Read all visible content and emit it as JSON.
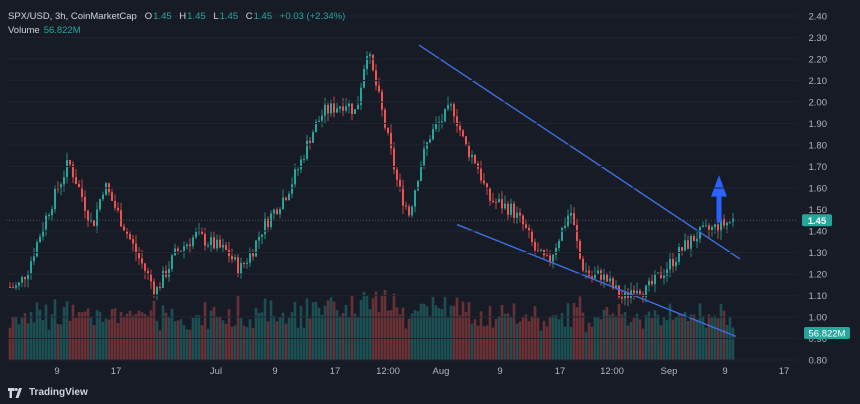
{
  "legend": {
    "symbol": "SPX/USD, 3h, CoinMarketCap",
    "o_label": "O",
    "o": "1.45",
    "h_label": "H",
    "h": "1.45",
    "l_label": "L",
    "l": "1.45",
    "c_label": "C",
    "c": "1.45",
    "change": "+0.03 (+2.34%)",
    "volume_label": "Volume",
    "volume_value": "56.822M"
  },
  "branding": {
    "name": "TradingView"
  },
  "colors": {
    "background": "#171b26",
    "up": "#26a69a",
    "down": "#ef5350",
    "trendline": "#3f6fe0",
    "arrow": "#2962ff",
    "text": "#b2b5be",
    "price_tag": "#26a69a",
    "volume_tag": "#26a69a"
  },
  "chart_data": {
    "type": "candlestick",
    "ylim": [
      0.8,
      2.4
    ],
    "y_ticks": [
      "2.40",
      "2.30",
      "2.20",
      "2.10",
      "2.00",
      "1.90",
      "1.80",
      "1.70",
      "1.60",
      "1.50",
      "1.40",
      "1.30",
      "1.20",
      "1.10",
      "1.00",
      "0.90",
      "0.80"
    ],
    "x_ticks": [
      "9",
      "17",
      "Jul",
      "9",
      "17",
      "12:00",
      "Aug",
      "9",
      "17",
      "12:00",
      "Sep",
      "9",
      "17"
    ],
    "last_price": "1.45",
    "last_volume": "56.822M",
    "close_path": [
      [
        "9",
        1.14
      ],
      [
        "9",
        1.22
      ],
      [
        "9",
        1.35
      ],
      [
        "9",
        1.48
      ],
      [
        "17",
        1.72
      ],
      [
        "17",
        1.58
      ],
      [
        "17",
        1.42
      ],
      [
        "17",
        1.62
      ],
      [
        "Jul",
        1.3
      ],
      [
        "Jul",
        1.12
      ],
      [
        "Jul",
        1.3
      ],
      [
        "Jul",
        1.38
      ],
      [
        "9",
        1.3
      ],
      [
        "9",
        1.22
      ],
      [
        "9",
        1.3
      ],
      [
        "9",
        1.42
      ],
      [
        "17",
        1.58
      ],
      [
        "17",
        1.7
      ],
      [
        "17",
        1.85
      ],
      [
        "17",
        1.95
      ],
      [
        "12:00",
        2.0
      ],
      [
        "12:00",
        1.95
      ],
      [
        "12:00",
        2.25
      ],
      [
        "12:00",
        2.05
      ],
      [
        "Aug",
        1.6
      ],
      [
        "Aug",
        1.48
      ],
      [
        "Aug",
        1.7
      ],
      [
        "Aug",
        1.85
      ],
      [
        "9",
        1.98
      ],
      [
        "9",
        1.8
      ],
      [
        "9",
        1.72
      ],
      [
        "9",
        1.55
      ],
      [
        "17",
        1.5
      ],
      [
        "17",
        1.42
      ],
      [
        "17",
        1.3
      ],
      [
        "17",
        1.25
      ],
      [
        "12:00",
        1.5
      ],
      [
        "12:00",
        1.25
      ],
      [
        "12:00",
        1.18
      ],
      [
        "12:00",
        1.2
      ],
      [
        "Sep",
        1.08
      ],
      [
        "Sep",
        1.15
      ],
      [
        "Sep",
        1.12
      ],
      [
        "Sep",
        1.18
      ],
      [
        "9",
        1.32
      ],
      [
        "9",
        1.38
      ],
      [
        "9",
        1.45
      ]
    ],
    "annotations": [
      {
        "type": "trendline",
        "label": "upper",
        "from": [
          "Aug",
          2.27
        ],
        "to": [
          "9",
          1.28
        ]
      },
      {
        "type": "trendline",
        "label": "lower",
        "from": [
          "Aug",
          1.43
        ],
        "to": [
          "9",
          0.91
        ]
      },
      {
        "type": "arrow",
        "direction": "up",
        "at": [
          "9",
          1.55
        ]
      }
    ]
  }
}
